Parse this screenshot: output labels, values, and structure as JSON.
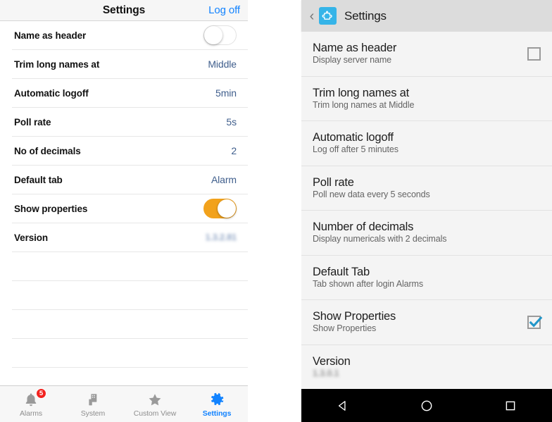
{
  "ios": {
    "navbar": {
      "title": "Settings",
      "logoff_label": "Log off"
    },
    "rows": [
      {
        "label": "Name as header",
        "control": "toggle",
        "toggle_state": "off"
      },
      {
        "label": "Trim long names at",
        "control": "value",
        "value": "Middle"
      },
      {
        "label": "Automatic logoff",
        "control": "value",
        "value": "5min"
      },
      {
        "label": "Poll rate",
        "control": "value",
        "value": "5s"
      },
      {
        "label": "No of decimals",
        "control": "value",
        "value": "2"
      },
      {
        "label": "Default tab",
        "control": "value",
        "value": "Alarm"
      },
      {
        "label": "Show properties",
        "control": "toggle",
        "toggle_state": "on"
      },
      {
        "label": "Version",
        "control": "value-blurred",
        "value": "1.3.2.81"
      }
    ],
    "empty_row_count": 5,
    "tabbar": [
      {
        "label": "Alarms",
        "icon": "bell-icon",
        "badge": "5",
        "active": false
      },
      {
        "label": "System",
        "icon": "building-icon",
        "badge": "",
        "active": false
      },
      {
        "label": "Custom View",
        "icon": "star-icon",
        "badge": "",
        "active": false
      },
      {
        "label": "Settings",
        "icon": "gear-icon",
        "badge": "",
        "active": true
      }
    ],
    "colors": {
      "accent_blue": "#1283ff",
      "value_blue": "#3f5e8c",
      "toggle_on": "#f2a21c",
      "badge_red": "#f2231f"
    }
  },
  "android": {
    "appbar": {
      "title": "Settings",
      "back_icon": "chevron-left-icon",
      "app_icon": "puzzle-piece-icon"
    },
    "rows": [
      {
        "title": "Name as header",
        "subtitle": "Display server name",
        "control": "checkbox",
        "checked": false
      },
      {
        "title": "Trim long names at",
        "subtitle": "Trim long names at Middle",
        "control": "none",
        "checked": false
      },
      {
        "title": "Automatic logoff",
        "subtitle": "Log off after 5 minutes",
        "control": "none",
        "checked": false
      },
      {
        "title": "Poll rate",
        "subtitle": "Poll new data every 5 seconds",
        "control": "none",
        "checked": false
      },
      {
        "title": "Number of decimals",
        "subtitle": "Display numericals with 2 decimals",
        "control": "none",
        "checked": false
      },
      {
        "title": "Default Tab",
        "subtitle": "Tab shown after login Alarms",
        "control": "none",
        "checked": false
      },
      {
        "title": "Show Properties",
        "subtitle": "Show Properties",
        "control": "checkbox",
        "checked": true
      },
      {
        "title": "Version",
        "subtitle": "1.3.0.1",
        "control": "none",
        "blurred": true,
        "checked": false
      }
    ],
    "navbar": [
      {
        "icon": "back-triangle-icon",
        "name": "back"
      },
      {
        "icon": "home-circle-icon",
        "name": "home"
      },
      {
        "icon": "recents-square-icon",
        "name": "recents"
      }
    ],
    "colors": {
      "app_icon_blue": "#35b4e8",
      "check_blue": "#2196c9",
      "appbar_bg": "#dcdcdc"
    }
  }
}
